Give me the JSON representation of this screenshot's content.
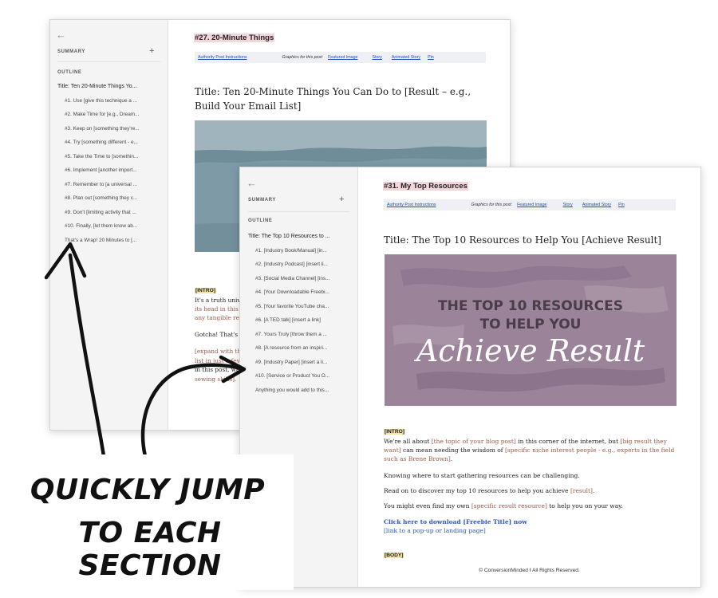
{
  "back_doc": {
    "sidebar": {
      "back_glyph": "←",
      "summary_label": "SUMMARY",
      "plus_glyph": "+",
      "outline_label": "OUTLINE",
      "items": [
        "Title: Ten 20-Minute Things Yo...",
        "#1. Use [give this technique a ...",
        "#2. Make Time for [e.g., Dream...",
        "#3. Keep on [something they're...",
        "#4. Try [something different - e...",
        "#5. Take the Time to [somethin...",
        "#6. Implement [another import...",
        "#7. Remember to [a universal ...",
        "#8. Plan out [something they c...",
        "#9. Don't [limiting activity that ...",
        "#10. Finally, [let them know ab...",
        "That's a Wrap! 20 Minutes to [..."
      ]
    },
    "header": "#27. 20-Minute Things",
    "graphics_bar": {
      "instructions": "Authority Post Instructions",
      "graphics_label": "Graphics for this post:",
      "links": [
        "Featured Image",
        "Story",
        "Animated Story",
        "Pin"
      ]
    },
    "post_title": "Title: Ten 20-Minute Things You Can Do to [Result – e.g., Build Your Email List]",
    "intro_tag": "[INTRO]",
    "p1_lines": [
      "It's a truth univ",
      "its head in this p",
      "any tangible res"
    ],
    "p2": "Gotcha! That's a",
    "p3_lines": [
      "[expand with th",
      "list in just a few",
      "in this post, we",
      "sewing skills]."
    ]
  },
  "front_doc": {
    "sidebar": {
      "back_glyph": "←",
      "summary_label": "SUMMARY",
      "plus_glyph": "+",
      "outline_label": "OUTLINE",
      "items": [
        "Title: The Top 10 Resources to ...",
        "#1. [Industry Book/Manual] [in...",
        "#2. [Industry Podcast] [insert li...",
        "#3. [Social Media Channel] [ins...",
        "#4. [Your Downloadable Freebi...",
        "#5. [Your favorite YouTube cha...",
        "#6. [A TED talk] [insert a link]",
        "#7. Yours Truly [throw them a ...",
        "#8. [A resource from an inspiri...",
        "#9. [Industry Paper] [insert a li...",
        "#10. [Service or Product You O...",
        "Anything you would add to this..."
      ]
    },
    "header": "#31. My Top Resources",
    "graphics_bar": {
      "instructions": "Authority Post Instructions",
      "graphics_label": "Graphics for this post:",
      "links": [
        "Featured Image",
        "Story",
        "Animated Story",
        "Pin"
      ]
    },
    "post_title": "Title: The Top 10 Resources to Help You [Achieve Result]",
    "banner": {
      "line1": "THE TOP 10 RESOURCES",
      "line2": "TO HELP YOU",
      "script": "Achieve Result"
    },
    "intro_tag": "[INTRO]",
    "p1": {
      "a": "We're all about ",
      "b": "[the topic of your blog post]",
      "c": " in this corner of the internet, but ",
      "d": "[big result they want]",
      "e": " can mean needing the wisdom of ",
      "f": "[specific niche interest people - e.g., experts in the field such as Brene Brown]",
      "g": "."
    },
    "p2": "Knowing where to start gathering resources can be challenging.",
    "p3": {
      "a": "Read on to discover my top 10 resources to help you achieve ",
      "b": "[result]",
      "c": "."
    },
    "p4": {
      "a": "You might even find my own ",
      "b": "[specific result resource]",
      "c": " to help you on your way."
    },
    "cta": "Click here to download [Freebie Title] now",
    "cta_sub": "[link to a pop-up or landing page]",
    "body_tag": "[BODY]",
    "footer": "© ConversionMinded  I All Rights Reserved."
  },
  "callout": {
    "line1": "QUICKLY JUMP",
    "line2": "TO EACH SECTION"
  },
  "colors": {
    "banner_teal": "#7d9aa6",
    "banner_purple": "#9b8499",
    "header_highlight": "#f3d6dc",
    "tag_highlight": "#f3e2a8",
    "placeholder_text": "#9b5a4a",
    "link_blue": "#2f56c8"
  }
}
